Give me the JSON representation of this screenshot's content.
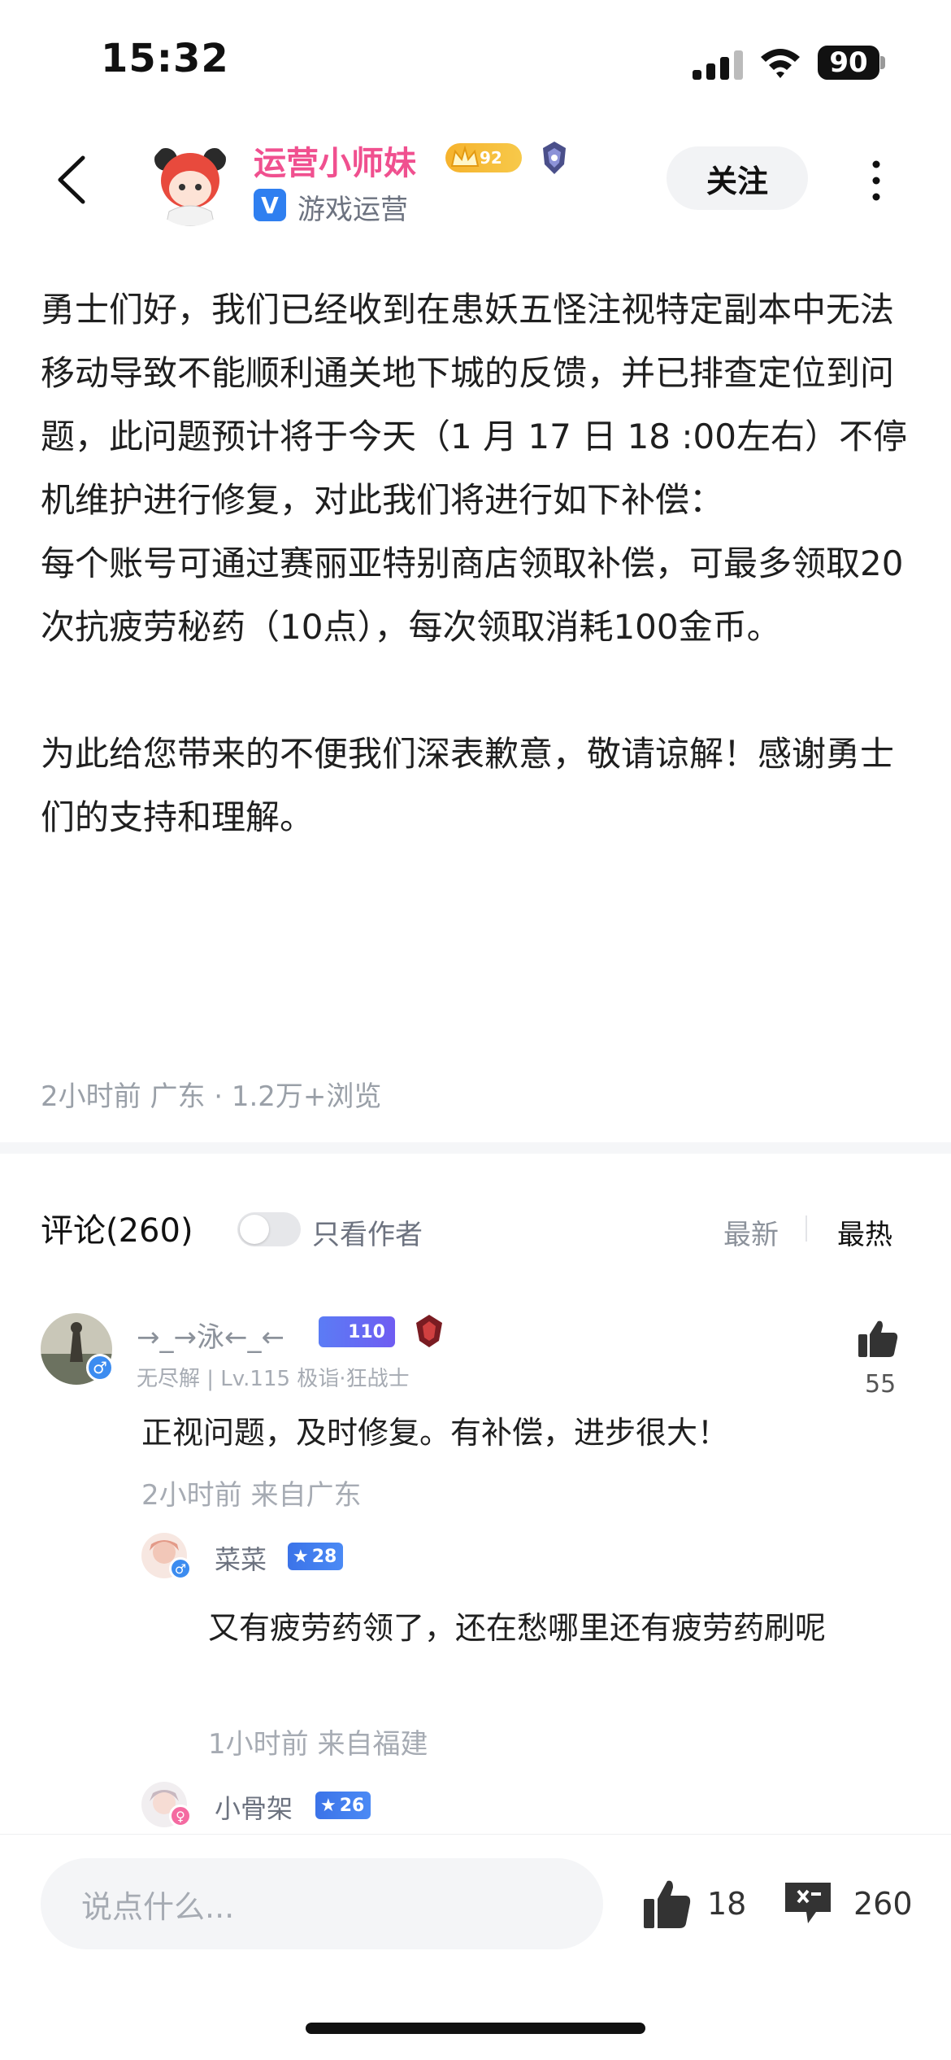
{
  "status_bar": {
    "time": "15:32",
    "battery": "90"
  },
  "header": {
    "author_name": "运营小师妹",
    "author_level": "92",
    "verified_mark": "V",
    "author_role": "游戏运营",
    "follow_label": "关注"
  },
  "post": {
    "content": "勇士们好，我们已经收到在患妖五怪注视特定副本中无法移动导致不能顺利通关地下城的反馈，并已排查定位到问题，此问题预计将于今天（1 月 17 日 18 :00左右）不停机维护进行修复，对此我们将进行如下补偿：\n每个账号可通过赛丽亚特别商店领取补偿，可最多领取20次抗疲劳秘药（10点），每次领取消耗100金币。\n\n为此给您带来的不便我们深表歉意，敬请谅解！感谢勇士们的支持和理解。",
    "meta": "2小时前 广东 · 1.2万+浏览"
  },
  "comments_section": {
    "title": "评论(260)",
    "author_only_label": "只看作者",
    "sort_newest": "最新",
    "sort_hottest": "最热",
    "comments": [
      {
        "user": "→_→泳←_←",
        "level": "110",
        "sub": "无尽解 | Lv.115 极诣·狂战士",
        "text": "正视问题，及时修复。有补偿，进步很大！",
        "time": "2小时前  来自广东",
        "likes": "55",
        "gender": "♂"
      }
    ],
    "replies": [
      {
        "user": "菜菜",
        "level": "28",
        "text": "又有疲劳药领了，还在愁哪里还有疲劳药刷呢",
        "time": "1小时前  来自福建",
        "gender": "♂"
      },
      {
        "user": "小骨架",
        "level": "26",
        "gender": "♀"
      }
    ]
  },
  "bottom_bar": {
    "input_placeholder": "说点什么...",
    "like_count": "18",
    "comment_count": "260"
  },
  "colors": {
    "author_name": "#f0508f",
    "accent_blue": "#2f7ff0",
    "gold_badge": "#f6b22c"
  },
  "icons": [
    "back-arrow-icon",
    "crown-icon",
    "rank-emblem-icon",
    "verified-icon",
    "more-vertical-icon",
    "thumb-up-icon",
    "comment-icon",
    "signal-icon",
    "wifi-icon",
    "battery-icon"
  ]
}
